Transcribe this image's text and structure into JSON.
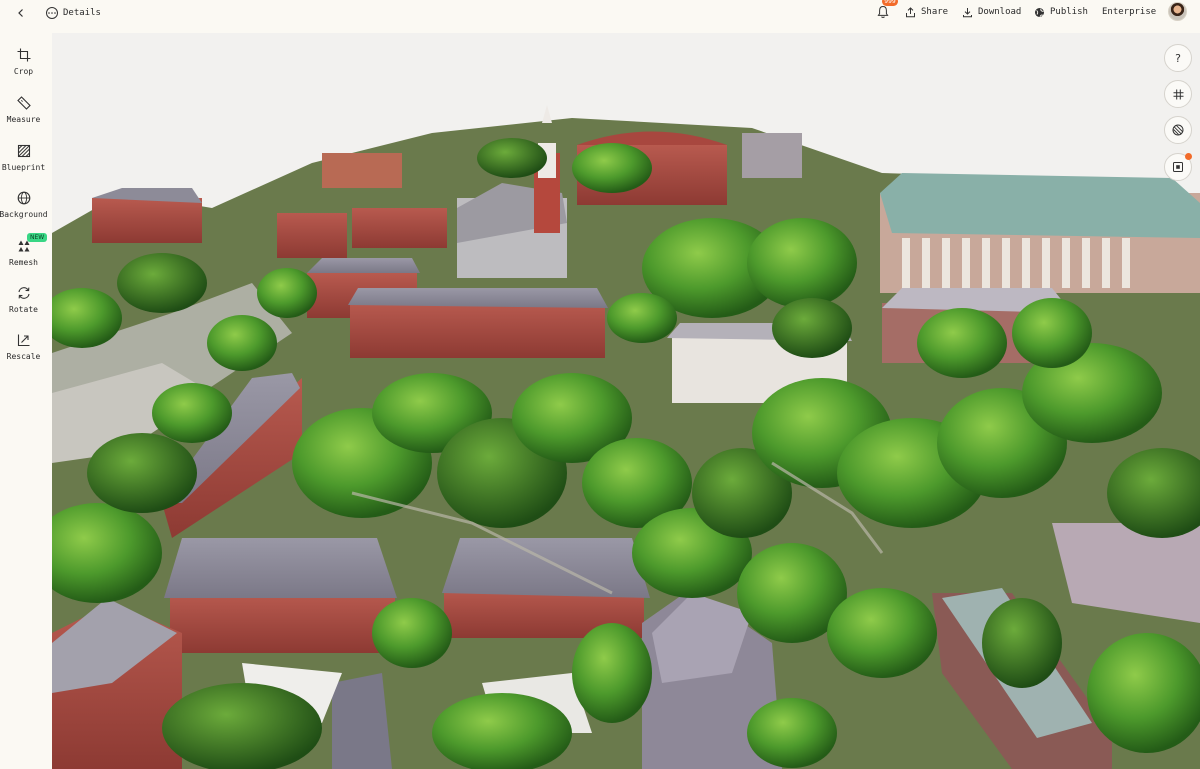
{
  "header": {
    "details_label": "Details",
    "notification_count": "999",
    "share_label": "Share",
    "download_label": "Download",
    "publish_label": "Publish",
    "enterprise_label": "Enterprise"
  },
  "toolbar": {
    "crop": "Crop",
    "measure": "Measure",
    "blueprint": "Blueprint",
    "background": "Background",
    "remesh": "Remesh",
    "remesh_badge": "NEW",
    "rotate": "Rotate",
    "rescale": "Rescale"
  },
  "viewport_controls": {
    "help": "?"
  },
  "colors": {
    "accent": "#f26b2a",
    "new_badge": "#38d684",
    "background": "#fbf9f3"
  },
  "icons": [
    "back-icon",
    "dots-circle-icon",
    "bell-icon",
    "share-icon",
    "download-icon",
    "globe-icon",
    "crop-icon",
    "ruler-icon",
    "blueprint-icon",
    "globe-icon",
    "remesh-icon",
    "rotate-icon",
    "rescale-icon",
    "help-icon",
    "grid-icon",
    "layers-icon",
    "frame-icon"
  ]
}
